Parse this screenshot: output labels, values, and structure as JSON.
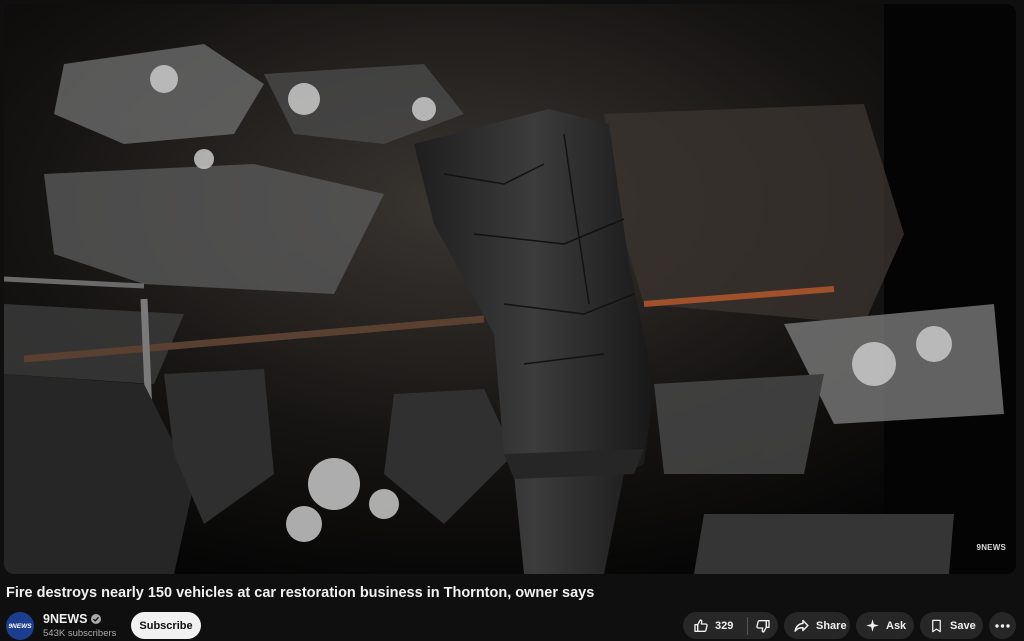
{
  "video": {
    "watermark": "9NEWS",
    "title": "Fire destroys nearly 150 vehicles at car restoration business in Thornton, owner says"
  },
  "channel": {
    "name": "9NEWS",
    "avatar_text": "9NEWS",
    "subscribers": "543K subscribers",
    "verified": true
  },
  "actions": {
    "subscribe_label": "Subscribe",
    "like_count": "329",
    "share_label": "Share",
    "ask_label": "Ask",
    "save_label": "Save"
  },
  "icons": {
    "like": "thumbs-up-icon",
    "dislike": "thumbs-down-icon",
    "share": "share-arrow-icon",
    "ask": "sparkle-icon",
    "save": "bookmark-icon",
    "more": "more-horizontal-icon",
    "verified": "checkmark-badge-icon"
  },
  "colors": {
    "background": "#0f0f0f",
    "button_bg": "#272727",
    "subscribe_bg": "#f1f1f1",
    "text_primary": "#f1f1f1",
    "text_secondary": "#aaaaaa"
  }
}
